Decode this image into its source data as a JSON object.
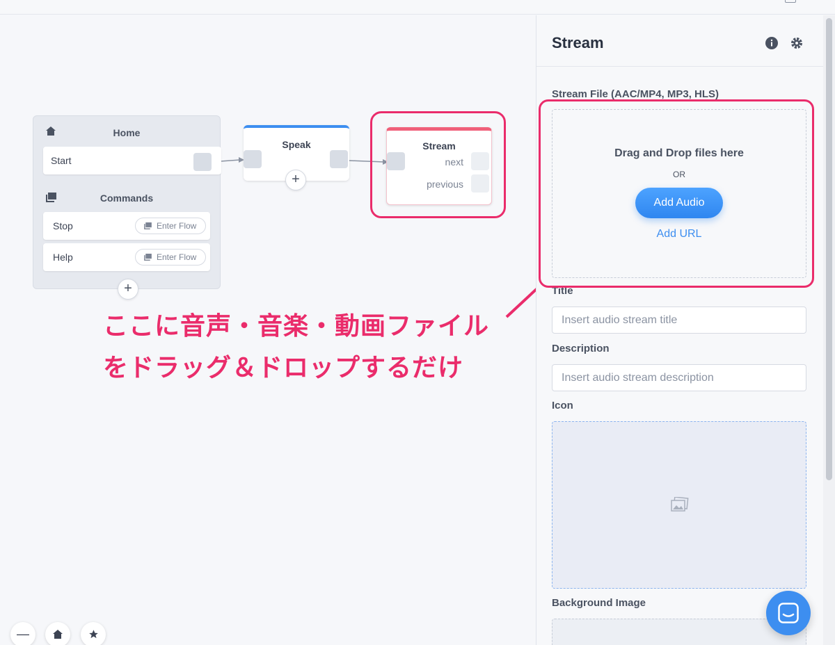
{
  "canvas": {
    "home_block": {
      "home_title": "Home",
      "start_label": "Start",
      "commands_title": "Commands",
      "commands": [
        {
          "label": "Stop",
          "action": "Enter Flow"
        },
        {
          "label": "Help",
          "action": "Enter Flow"
        }
      ]
    },
    "speak_block": {
      "title": "Speak"
    },
    "stream_block": {
      "title": "Stream",
      "ports": [
        "next",
        "previous"
      ]
    },
    "add_symbol": "+",
    "annotation": {
      "line1": "ここに音声・音楽・動画ファイル",
      "line2": "をドラッグ＆ドロップするだけ",
      "color": "#ea2c6b"
    },
    "controls": {
      "zoom_out": "—",
      "home": "home-icon",
      "favorite": "star-icon"
    }
  },
  "panel": {
    "title": "Stream",
    "stream_file": {
      "label": "Stream File (AAC/MP4, MP3, HLS)",
      "drag_text": "Drag and Drop files here",
      "or_text": "OR",
      "add_audio": "Add Audio",
      "add_url": "Add URL"
    },
    "title_field": {
      "label": "Title",
      "placeholder": "Insert audio stream title"
    },
    "description_field": {
      "label": "Description",
      "placeholder": "Insert audio stream description"
    },
    "icon_field": {
      "label": "Icon"
    },
    "background_field": {
      "label": "Background Image"
    }
  },
  "colors": {
    "accent": "#3d8ef0",
    "highlight": "#ea2c6b",
    "stream_header": "#f0607a"
  }
}
